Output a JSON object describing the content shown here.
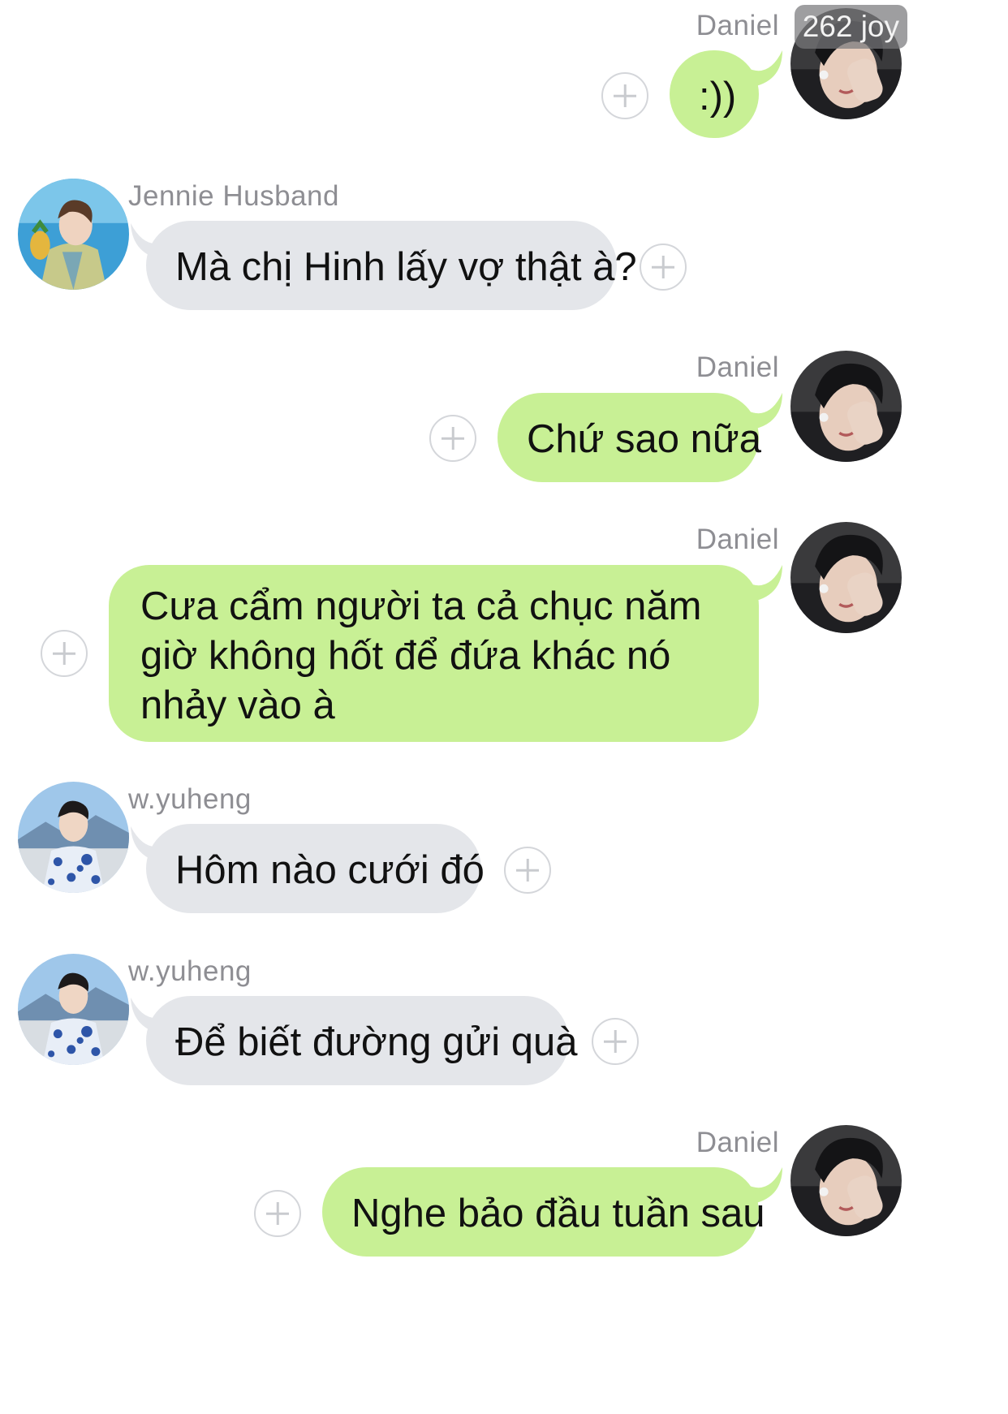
{
  "badge": {
    "text": "262 joy"
  },
  "messages": [
    {
      "sender": "Daniel",
      "text": ":))",
      "direction": "outgoing"
    },
    {
      "sender": "Jennie Husband",
      "text": "Mà chị Hinh lấy vợ thật à?",
      "direction": "incoming"
    },
    {
      "sender": "Daniel",
      "text": "Chứ sao nữa",
      "direction": "outgoing"
    },
    {
      "sender": "Daniel",
      "text": "Cưa cẩm người ta cả chục năm giờ không hốt để đứa khác nó nhảy vào à",
      "direction": "outgoing"
    },
    {
      "sender": "w.yuheng",
      "text": "Hôm nào cưới đó",
      "direction": "incoming"
    },
    {
      "sender": "w.yuheng",
      "text": "Để biết đường gửi quà",
      "direction": "incoming"
    },
    {
      "sender": "Daniel",
      "text": "Nghe bảo đầu tuần sau",
      "direction": "outgoing"
    }
  ],
  "colors": {
    "incoming_bubble": "#e4e6ea",
    "outgoing_bubble": "#c8f095",
    "name_text": "#8e8e93"
  },
  "icons": {
    "reaction": "plus-circle-icon"
  }
}
